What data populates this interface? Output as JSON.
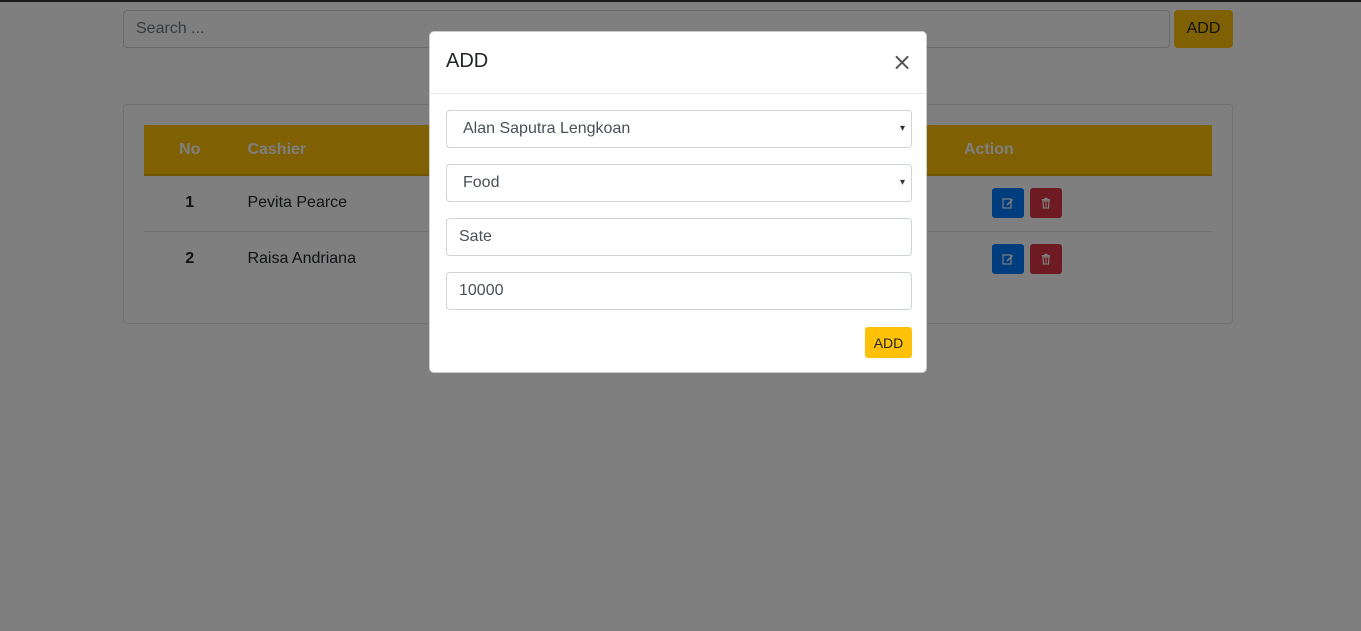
{
  "search": {
    "placeholder": "Search ...",
    "add_label": "ADD"
  },
  "table": {
    "headers": {
      "no": "No",
      "cashier": "Cashier",
      "action": "Action"
    },
    "rows": [
      {
        "no": "1",
        "cashier": "Pevita Pearce"
      },
      {
        "no": "2",
        "cashier": "Raisa Andriana"
      }
    ]
  },
  "modal": {
    "title": "ADD",
    "close_glyph": "×",
    "cashier_selected": "Alan Saputra Lengkoan",
    "category_selected": "Food",
    "name_value": "Sate",
    "price_value": "10000",
    "submit_label": "ADD",
    "select_arrow_glyph": "▾"
  },
  "colors": {
    "accent": "#ffc107",
    "edit": "#007bff",
    "delete": "#dc3545"
  },
  "icons": {
    "edit": "pencil-square-icon",
    "delete": "trash-icon"
  }
}
